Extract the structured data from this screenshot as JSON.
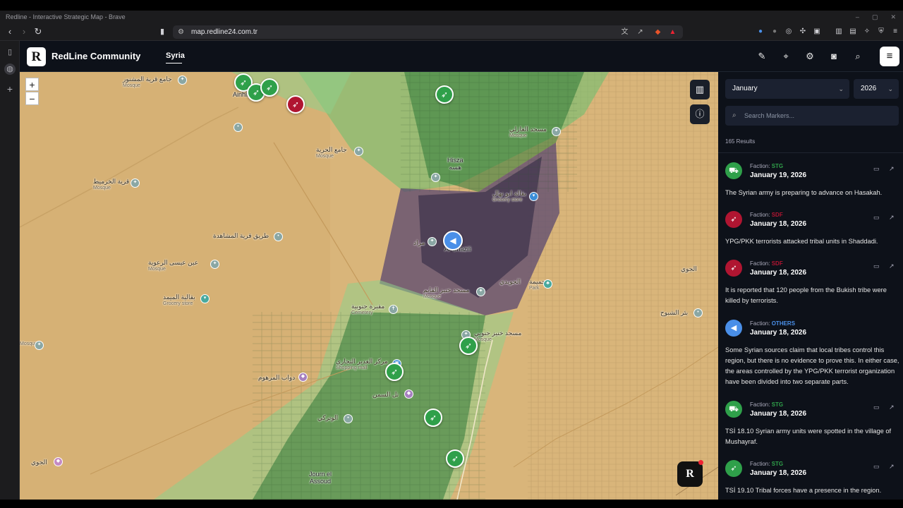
{
  "browser": {
    "window_title": "Redline - Interactive Strategic Map - Brave",
    "url": "map.redline24.com.tr"
  },
  "header": {
    "logo_letter": "R",
    "brand": "RedLine Community",
    "region_tab": "Syria",
    "icons": [
      "pen-icon",
      "map-pin-icon",
      "gear-icon",
      "camera-icon",
      "search-icon",
      "menu-icon"
    ]
  },
  "map": {
    "zoom_in": "+",
    "zoom_out": "−",
    "float_logo": "R",
    "town_labels": {
      "ainhil": "Ainhil",
      "hisza": "Hisza",
      "hisza_ar": "هسه",
      "al_ghazili": "Al Ghazili",
      "jourm": "Journ el Assoud"
    },
    "poi_labels": {
      "p1": "جامع قرية المشنور",
      "p1s": "Mosque",
      "p2": "جامع الحرية",
      "p2s": "Mosque",
      "p3": "قرية الخرميط",
      "p3s": "Mosque",
      "p4": "طريق قرية المشاهدة",
      "p5": "عين عيسى الرعوية",
      "p5s": "Mosque",
      "p6": "بقالية الميمد",
      "p6s": "Grocery store",
      "p7": "Mosque",
      "p8": "مسجد الغازلي",
      "p8s": "Mosque",
      "p9": "بقالة ابو نهال",
      "p9s": "Grocery store",
      "p10": "مسجد خنيز القايم",
      "p10s": "Mosque",
      "p11": "الجويدي",
      "p12": "مقبرة جنوبية",
      "p12s": "Cemetery",
      "p13": "مسجد خنيز جنوبي",
      "p13s": "Mosque",
      "p14": "مركز الغدير التجاري",
      "p14s": "Shopping mall",
      "p15": "دواب المرهوم",
      "p16": "تل السمن",
      "p17": "الوتركي",
      "p18": "الجوي",
      "p19": "بئر الشبوح",
      "p20": "حميمة",
      "p20s": "Park",
      "p21": "مراد",
      "p22": "الجوي"
    }
  },
  "panel": {
    "month": "January",
    "year": "2026",
    "search_placeholder": "Search Markers...",
    "results": "165 Results",
    "faction_prefix": "Faction:",
    "items": [
      {
        "faction": "STG",
        "color": "#2fa04a",
        "date": "January 19, 2026",
        "text": "The Syrian army is preparing to advance on Hasakah."
      },
      {
        "faction": "SDF",
        "color": "#b01531",
        "date": "January 18, 2026",
        "text": "YPG/PKK terrorists attacked tribal units in Shaddadi."
      },
      {
        "faction": "SDF",
        "color": "#b01531",
        "date": "January 18, 2026",
        "text": "It is reported that 120 people from the Bukish tribe were killed by terrorists."
      },
      {
        "faction": "OTHERS",
        "color": "#4a8fe8",
        "date": "January 18, 2026",
        "text": "Some Syrian sources claim that local tribes control this region, but there is no evidence to prove this. In either case, the areas controlled by the YPG/PKK terrorist organization have been divided into two separate parts."
      },
      {
        "faction": "STG",
        "color": "#2fa04a",
        "date": "January 18, 2026",
        "text": "TSİ 18.10 Syrian army units were spotted in the village of Mushayraf."
      },
      {
        "faction": "STG",
        "color": "#2fa04a",
        "date": "January 18, 2026",
        "text": "TSİ 19.10 Tribal forces have a presence in the region."
      }
    ]
  },
  "colors": {
    "stg": "#2fa04a",
    "sdf": "#b01531",
    "others": "#4a8fe8",
    "panel_bg": "#0d1119"
  }
}
